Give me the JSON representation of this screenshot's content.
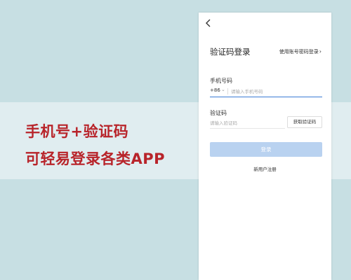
{
  "promo": {
    "line1": "手机号+验证码",
    "line2": "可轻易登录各类APP"
  },
  "login_screen": {
    "back_icon": "chevron-left-icon",
    "title": "验证码登录",
    "alt_login_link": "使用账号密码登录",
    "alt_login_icon": "chevron-right-icon",
    "phone_label": "手机号码",
    "country_code": "+86",
    "country_code_icon": "chevron-down-icon",
    "phone_placeholder": "请输入手机号码",
    "code_label": "验证码",
    "code_placeholder": "请输入验证码",
    "get_code_button": "获取验证码",
    "login_button": "登录",
    "register_link": "新用户注册"
  },
  "colors": {
    "background": "#c7dfe3",
    "headline": "#b8242a",
    "login_button_disabled": "#b9d2f0",
    "input_focus": "#3a7bd5"
  }
}
